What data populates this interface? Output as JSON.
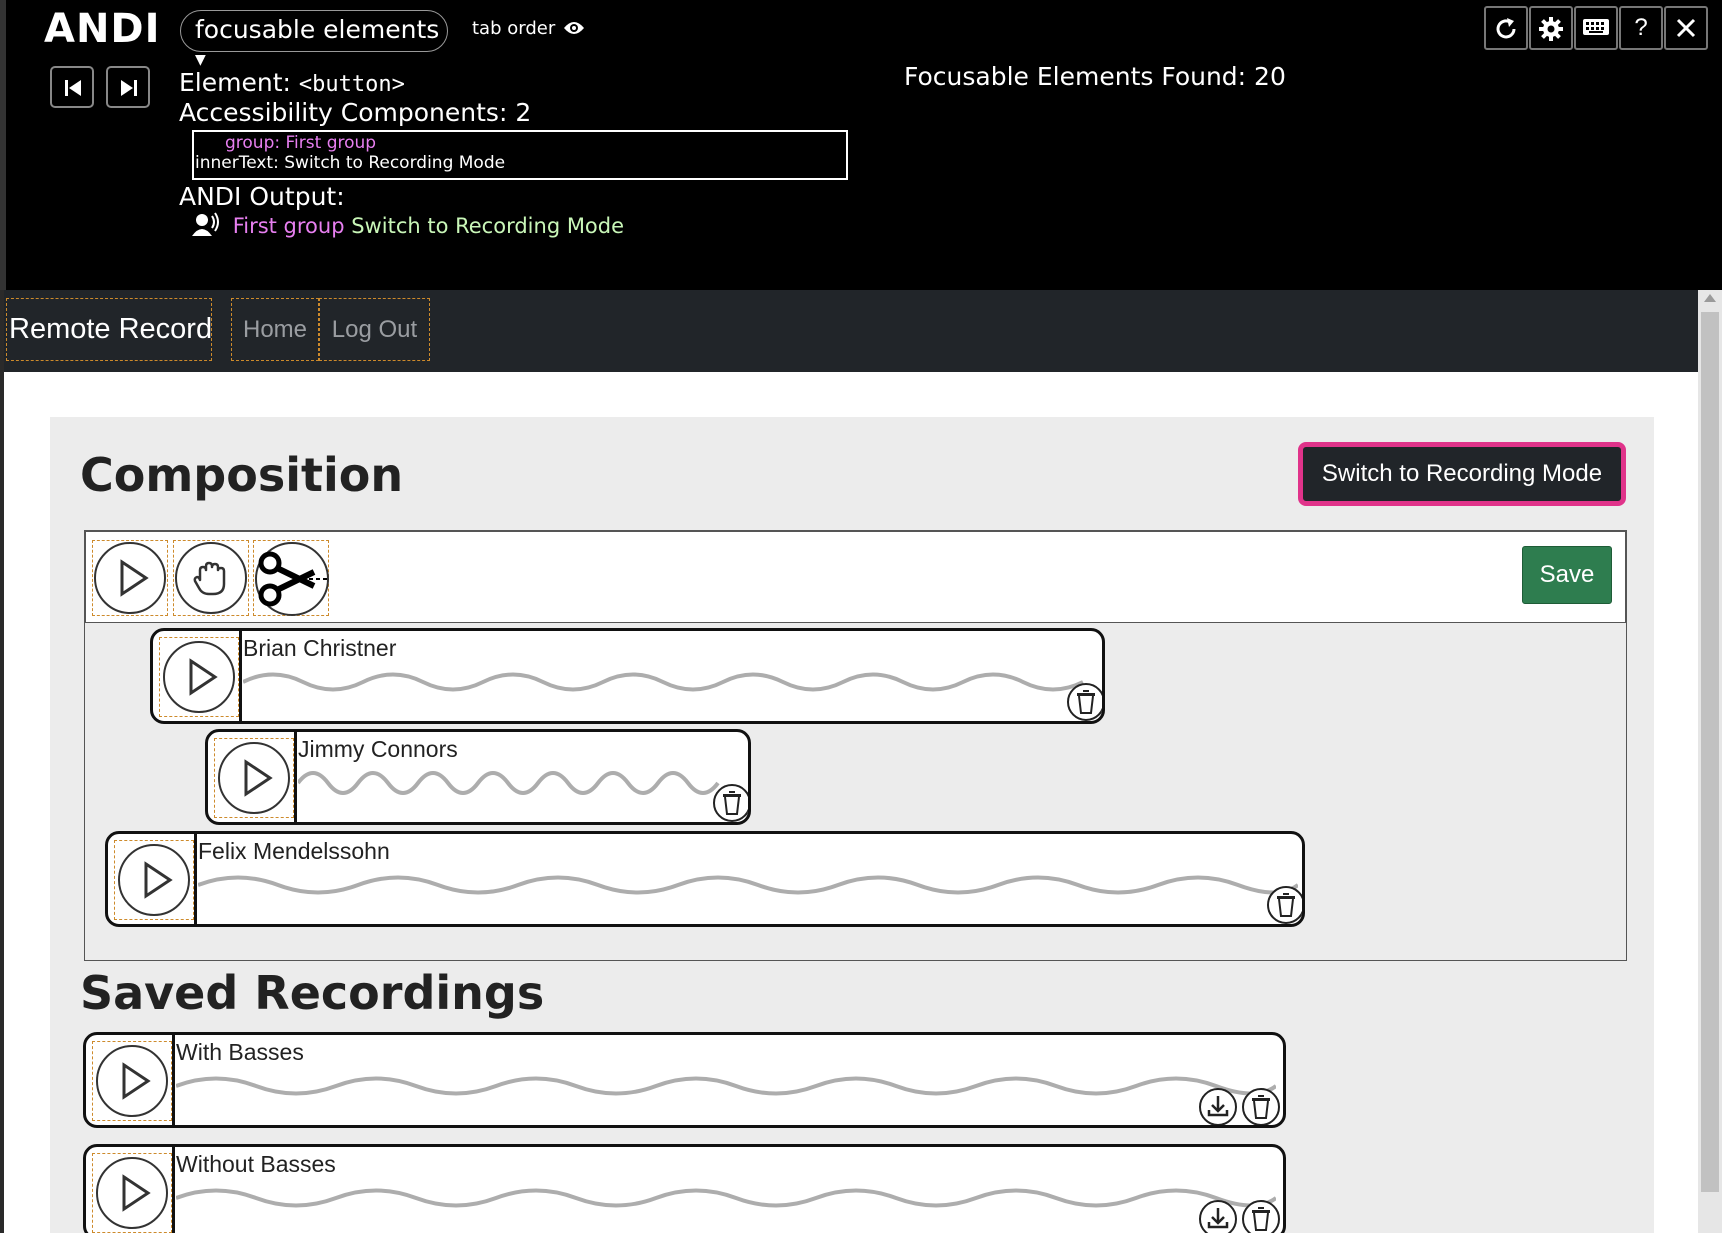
{
  "andi": {
    "logo": "ANDI",
    "mode": "focusable elements",
    "tab_order": "tab order",
    "element_label": "Element:",
    "element_value": "<button>",
    "components_label": "Accessibility Components: 2",
    "component_group_key": "group:",
    "component_group_value": "First group",
    "component_text_key": "innerText:",
    "component_text_value": "Switch to Recording Mode",
    "output_label": "ANDI Output:",
    "output_group": "First group",
    "output_text": "Switch to Recording Mode",
    "found": "Focusable Elements Found: 20",
    "help": "?"
  },
  "nav": {
    "brand": "Remote Record",
    "links": [
      "Home",
      "Log Out"
    ]
  },
  "composition": {
    "title": "Composition",
    "switch_button": "Switch to Recording Mode",
    "save_button": "Save",
    "tracks": [
      "Brian Christner",
      "Jimmy Connors",
      "Felix Mendelssohn"
    ]
  },
  "saved": {
    "title": "Saved Recordings",
    "recordings": [
      "With Basses",
      "Without Basses"
    ]
  },
  "colors": {
    "highlight": "#e0338a",
    "andi_pink": "#e77ff0",
    "save_green": "#2e7d4f",
    "focus_dash": "#cd8a2b"
  }
}
